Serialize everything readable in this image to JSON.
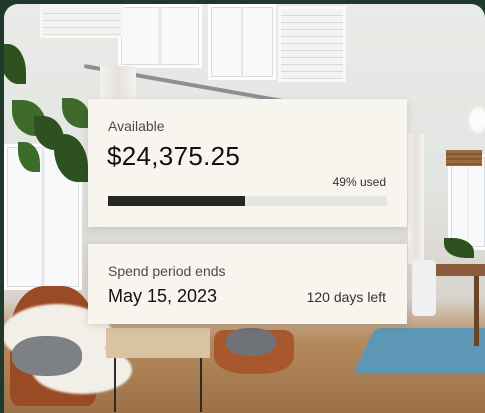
{
  "available": {
    "label": "Available",
    "amount": "$24,375.25",
    "used_label": "49% used",
    "used_fraction": 0.49
  },
  "spend_period": {
    "label": "Spend period ends",
    "date": "May 15, 2023",
    "days_left": "120 days left"
  },
  "colors": {
    "frame": "#1f3a2c",
    "card": "#f7f5ee",
    "bar_fill": "#262626",
    "bar_track": "#e6e6e1"
  }
}
